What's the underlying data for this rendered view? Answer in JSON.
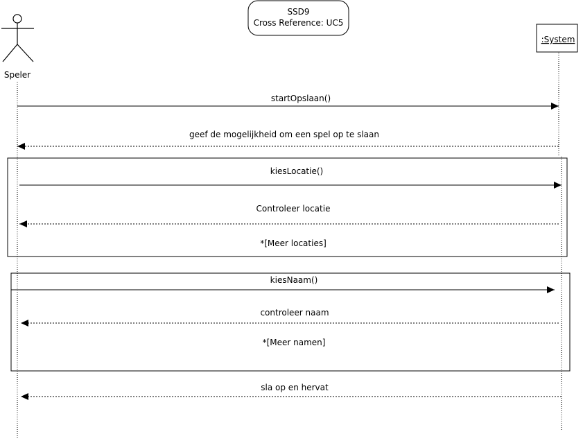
{
  "title_box": {
    "line1": "SSD9",
    "line2": "Cross Reference: UC5"
  },
  "actor": {
    "name": "Speler"
  },
  "system": {
    "name": ":System"
  },
  "messages": [
    {
      "label": "startOpslaan()",
      "kind": "call",
      "direction": "to-system"
    },
    {
      "label": "geef de mogelijkheid om een spel op te slaan",
      "kind": "return",
      "direction": "to-actor"
    },
    {
      "label": "kiesLocatie()",
      "kind": "call",
      "direction": "to-system"
    },
    {
      "label": "Controleer locatie",
      "kind": "return",
      "direction": "to-actor"
    },
    {
      "label": "kiesNaam()",
      "kind": "call",
      "direction": "to-system"
    },
    {
      "label": "controleer naam",
      "kind": "return",
      "direction": "to-actor"
    },
    {
      "label": "sla op en hervat",
      "kind": "return",
      "direction": "to-actor"
    }
  ],
  "loops": [
    {
      "guard": "*[Meer locaties]"
    },
    {
      "guard": "*[Meer namen]"
    }
  ]
}
